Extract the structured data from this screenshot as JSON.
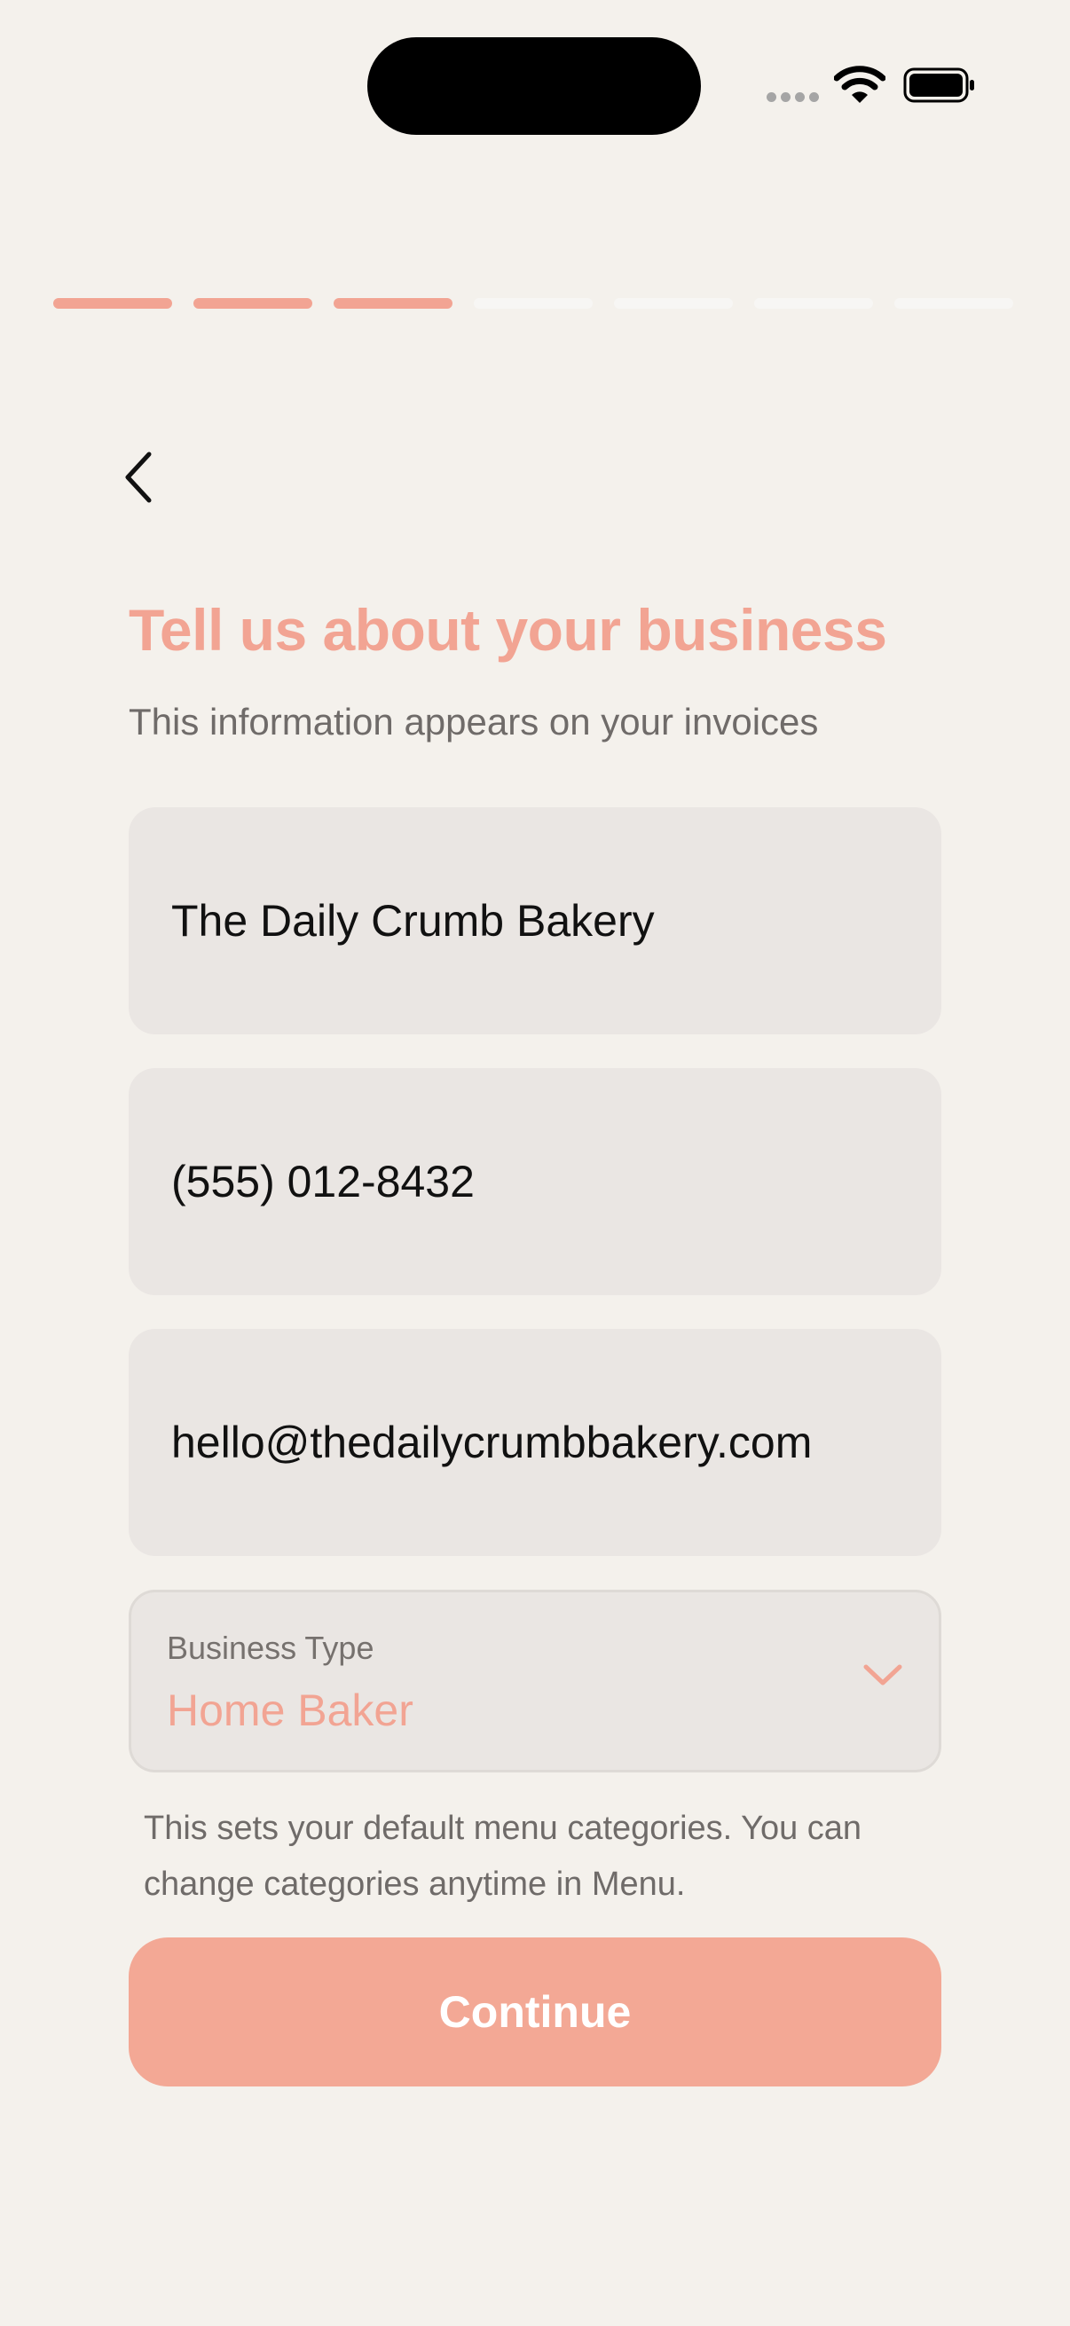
{
  "status_bar": {
    "signal_icon": "cellular-signal-icon",
    "wifi_icon": "wifi-icon",
    "battery_icon": "battery-icon"
  },
  "progress": {
    "total_steps": 7,
    "completed_steps": 3,
    "active_color": "#F2A493",
    "inactive_color": "#F7F6F4"
  },
  "header": {
    "back_icon": "chevron-left-icon",
    "title": "Tell us about your business",
    "subtitle": "This information appears on your invoices"
  },
  "form": {
    "business_name": {
      "value": "The Daily Crumb Bakery"
    },
    "phone": {
      "value": "(555) 012-8432"
    },
    "email": {
      "value": "hello@thedailycrumbbakery.com"
    },
    "business_type": {
      "label": "Business Type",
      "value": "Home Baker",
      "icon": "chevron-down-icon"
    },
    "helper_text": "This sets your default menu categories. You can change categories anytime in Menu."
  },
  "actions": {
    "continue_label": "Continue"
  },
  "colors": {
    "accent": "#F2A493",
    "button": "#F3A895",
    "background": "#F4F1EC",
    "field": "#EAE6E3"
  }
}
